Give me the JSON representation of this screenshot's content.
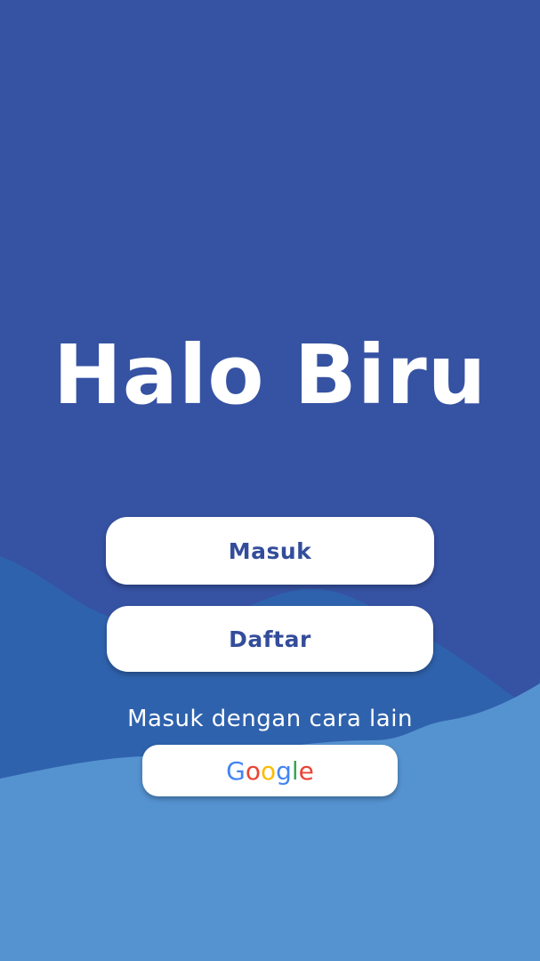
{
  "app": {
    "title": "Halo Biru"
  },
  "actions": {
    "login_label": "Masuk",
    "register_label": "Daftar",
    "alternate_label": "Masuk dengan cara lain"
  },
  "social_login": {
    "provider_letters": [
      "G",
      "o",
      "o",
      "g",
      "l",
      "e"
    ],
    "provider_colors": [
      "#4285f4",
      "#ea4335",
      "#fbbc05",
      "#4285f4",
      "#34a853",
      "#ea4335"
    ]
  },
  "colors": {
    "background": "#3652a3",
    "wave_mid": "#2f62ad",
    "wave_front": "#5592d0",
    "button_bg": "#ffffff",
    "button_text": "#334d9b"
  }
}
